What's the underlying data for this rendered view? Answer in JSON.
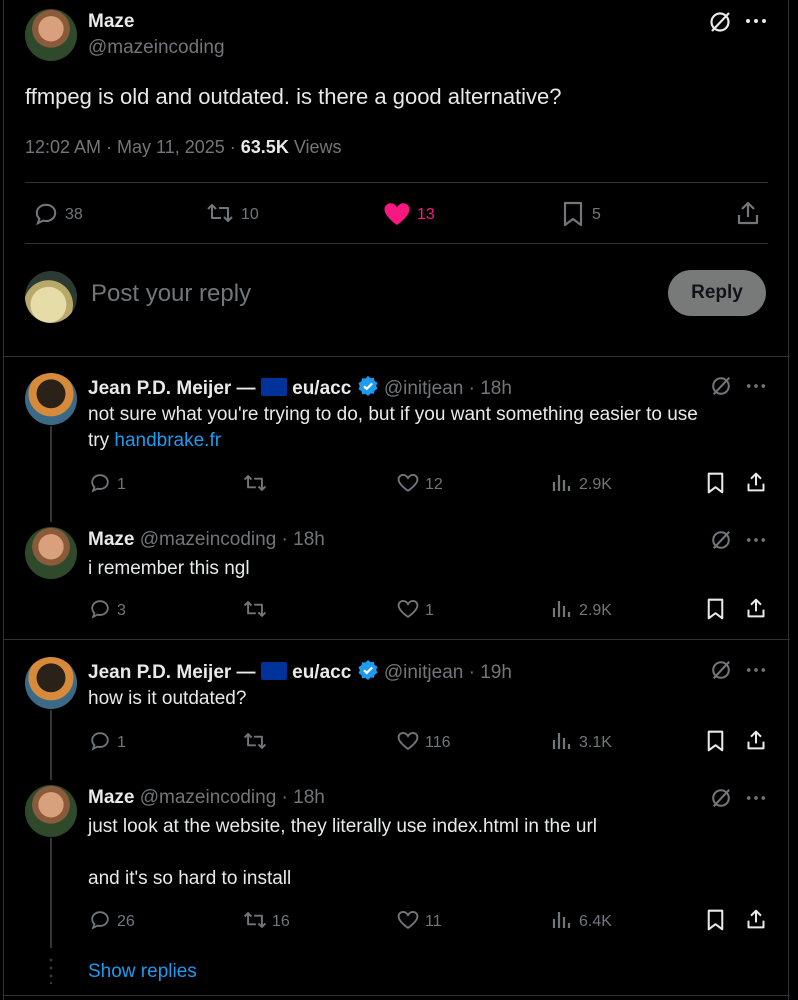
{
  "main_post": {
    "author_name": "Maze",
    "author_handle": "@mazeincoding",
    "text": "ffmpeg is old and outdated. is there a good alternative?",
    "timestamp": "12:02 AM · May 11, 2025 · ",
    "views_count": "63.5K",
    "views_label": " Views",
    "replies": "38",
    "reposts": "10",
    "likes": "13",
    "bookmarks": "5"
  },
  "reply_box": {
    "placeholder": "Post your reply",
    "button": "Reply"
  },
  "replies": [
    {
      "name_prefix": "Jean P.D. Meijer — ",
      "name_suffix": " eu/acc",
      "handle_time": "@initjean · 18h",
      "text_plain": "not sure what you're trying to do, but if you want something easier to use",
      "text_line2_prefix": "try ",
      "link": "handbrake.fr",
      "replies": "1",
      "reposts": "",
      "likes": "12",
      "views": "2.9K"
    },
    {
      "name": "Maze",
      "handle_time": "@mazeincoding · 18h",
      "text": "i remember this ngl",
      "replies": "3",
      "reposts": "",
      "likes": "1",
      "views": "2.9K"
    },
    {
      "name_prefix": "Jean P.D. Meijer — ",
      "name_suffix": " eu/acc",
      "handle_time": "@initjean · 19h",
      "text": "how is it outdated?",
      "replies": "1",
      "reposts": "",
      "likes": "116",
      "views": "3.1K"
    },
    {
      "name": "Maze",
      "handle_time": "@mazeincoding · 18h",
      "text_line1": "just look at the website, they literally use index.html in the url",
      "text_line2": "and it's so hard to install",
      "replies": "26",
      "reposts": "16",
      "likes": "11",
      "views": "6.4K"
    }
  ],
  "show_replies": "Show replies",
  "colors": {
    "background": "#000000",
    "accent": "#1d9bf0",
    "like": "#f91880",
    "muted": "#71767b",
    "text": "#e7e9ea"
  }
}
